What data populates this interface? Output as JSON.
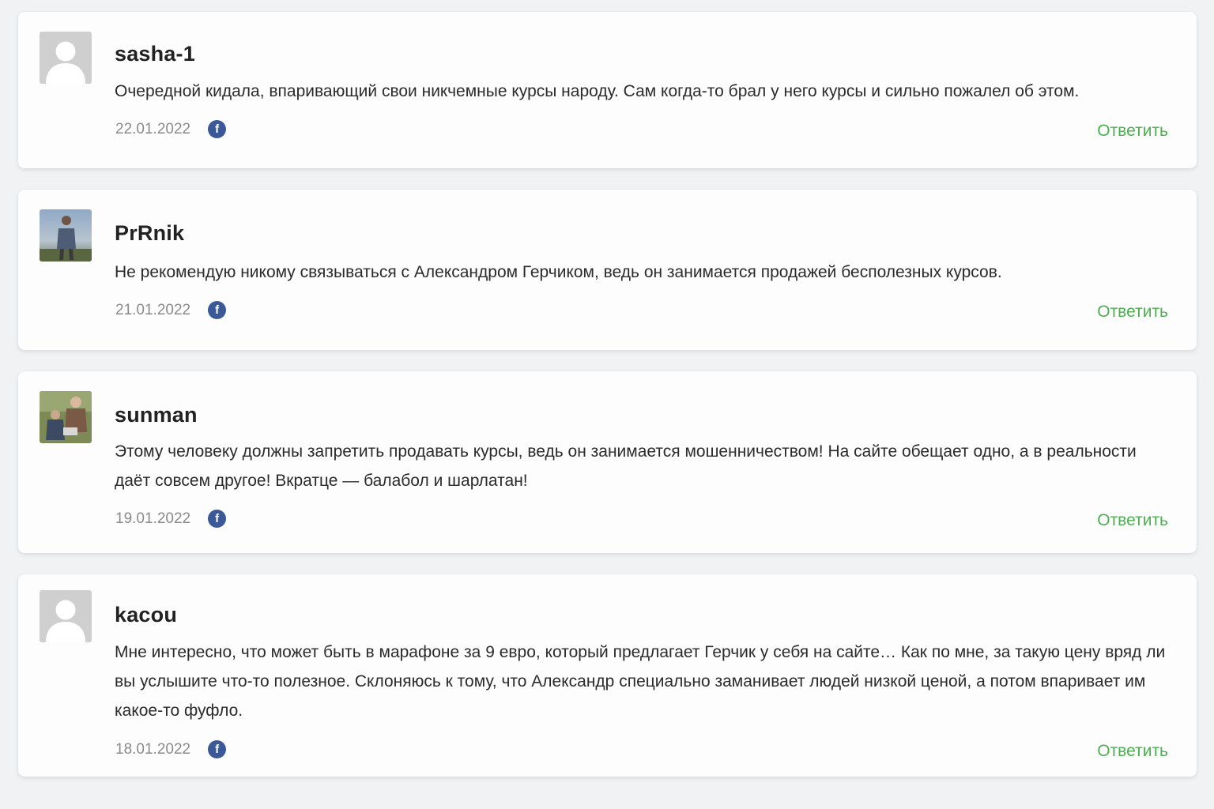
{
  "comments": [
    {
      "author": "sasha-1",
      "avatar": "default-avatar",
      "text": "Очередной кидала, впаривающий свои никчемные курсы народу. Сам когда-то брал у него курсы и сильно пожалел об этом.",
      "date": "22.01.2022",
      "share_icon": "f",
      "reply_label": "Ответить"
    },
    {
      "author": "PrRnik",
      "avatar": "photo-avatar",
      "text": "Не рекомендую никому связываться с Александром Герчиком, ведь он занимается продажей бесполезных курсов.",
      "date": "21.01.2022",
      "share_icon": "f",
      "reply_label": "Ответить"
    },
    {
      "author": "sunman",
      "avatar": "photo-avatar",
      "text": "Этому человеку должны запретить продавать курсы, ведь он занимается мошенничеством! На сайте обещает одно, а в реальности даёт совсем другое! Вкратце — балабол и шарлатан!",
      "date": "19.01.2022",
      "share_icon": "f",
      "reply_label": "Ответить"
    },
    {
      "author": "kacou",
      "avatar": "default-avatar",
      "text": "Мне интересно, что может быть в марафоне за 9 евро, который предлагает Герчик у себя на сайте… Как по мне, за такую цену вряд ли вы услышите что-то полезное. Склоняюсь к тому, что Александр специально заманивает людей низкой ценой, а потом впаривает им какое-то фуфло.",
      "date": "18.01.2022",
      "share_icon": "f",
      "reply_label": "Ответить"
    }
  ],
  "colors": {
    "page_background": "#f1f2f4",
    "card_background": "#fdfdfd",
    "reply_link": "#4caf50",
    "facebook": "#3b5998",
    "date_text": "#8b8b8b"
  }
}
